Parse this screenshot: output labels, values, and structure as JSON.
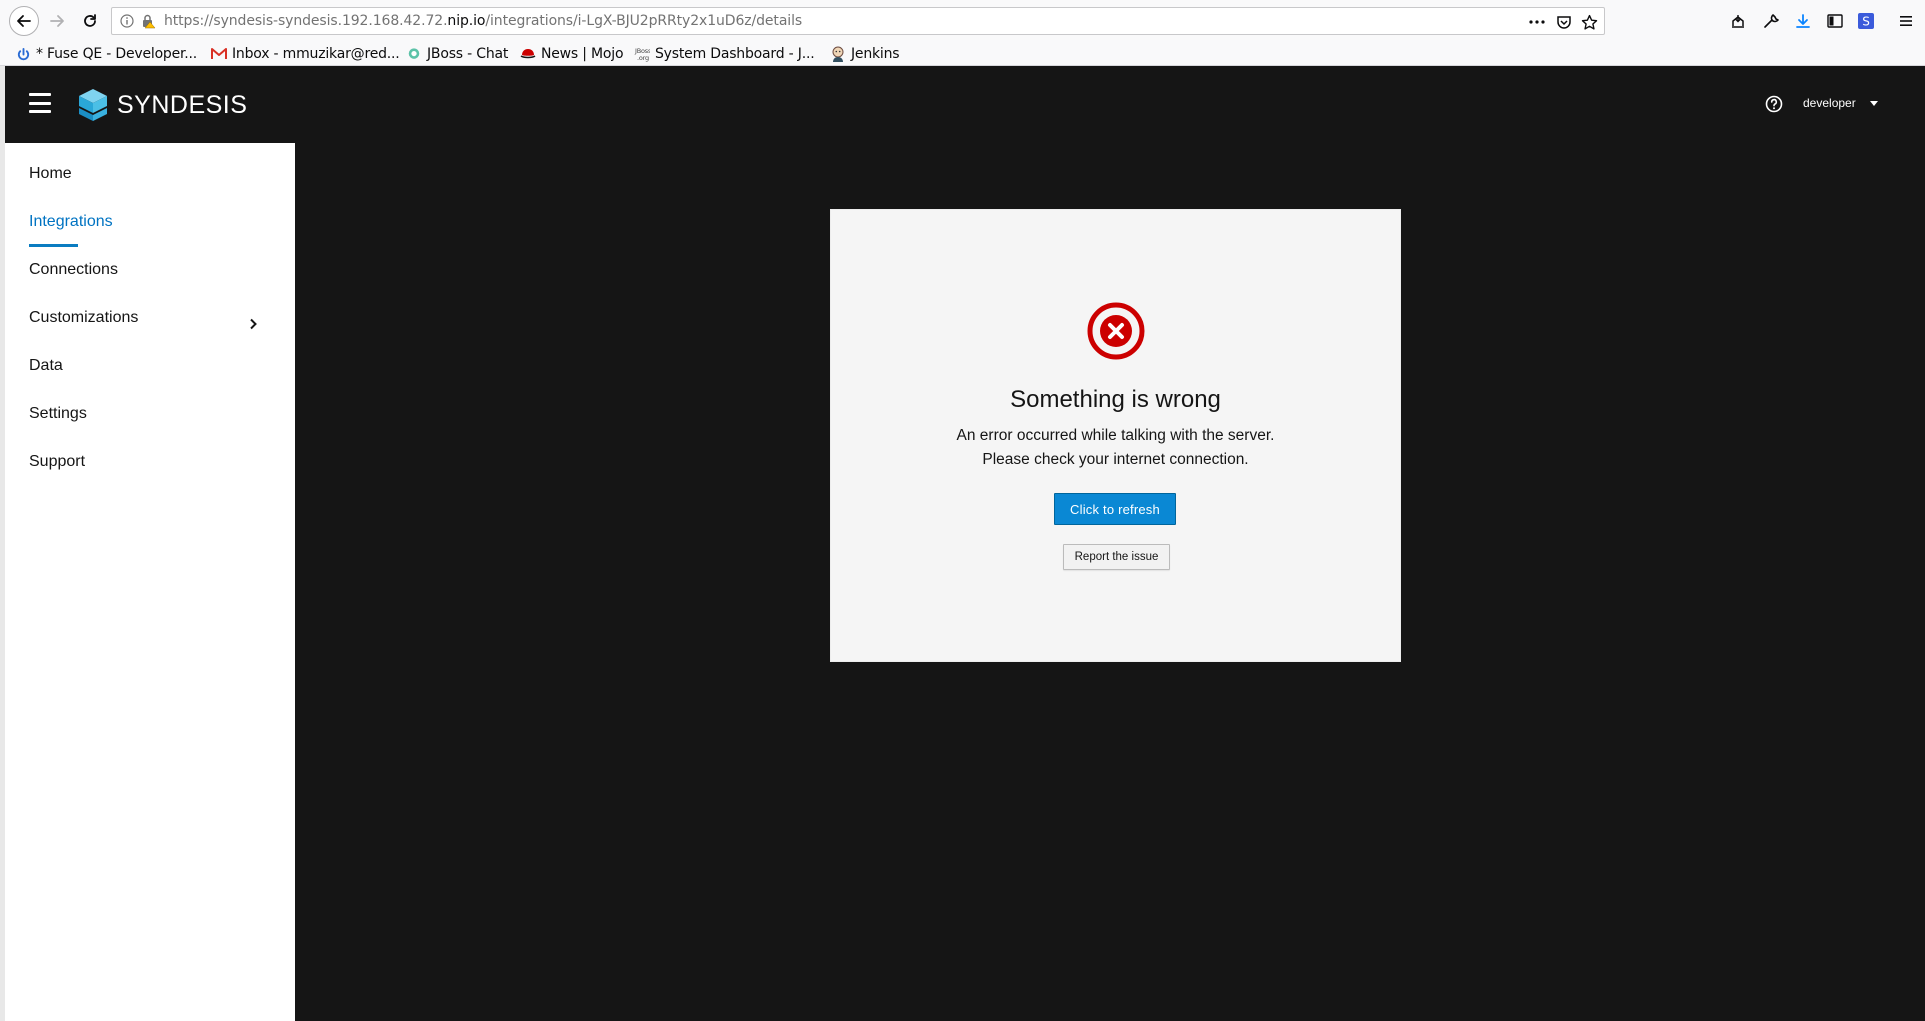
{
  "browser": {
    "url_prefix": "https://syndesis-syndesis.192.168.42.72.",
    "url_host": "nip.io",
    "url_path": "/integrations/i-LgX-BJU2pRRty2x1uD6z/details",
    "bookmarks": [
      {
        "label": "* Fuse QE - Developer...",
        "icon": "power-icon"
      },
      {
        "label": "Inbox - mmuzikar@red...",
        "icon": "gmail-icon"
      },
      {
        "label": "JBoss - Chat",
        "icon": "chat-icon"
      },
      {
        "label": "News | Mojo",
        "icon": "redhat-icon"
      },
      {
        "label": "System Dashboard - J...",
        "icon": "jboss-org-icon"
      },
      {
        "label": "Jenkins",
        "icon": "jenkins-icon"
      }
    ]
  },
  "app": {
    "brand": "SYNDESIS",
    "user": "developer",
    "nav": [
      {
        "label": "Home"
      },
      {
        "label": "Integrations",
        "active": true
      },
      {
        "label": "Connections"
      },
      {
        "label": "Customizations",
        "has_children": true
      },
      {
        "label": "Data"
      },
      {
        "label": "Settings"
      },
      {
        "label": "Support"
      }
    ]
  },
  "error": {
    "title": "Something is wrong",
    "message_line1": "An error occurred while talking with the server.",
    "message_line2": "Please check your internet connection.",
    "refresh_label": "Click to refresh",
    "report_label": "Report the issue"
  },
  "colors": {
    "accent": "#0073c2",
    "primary_button": "#0a88d4",
    "error": "#cc0000",
    "masthead": "#151515"
  }
}
